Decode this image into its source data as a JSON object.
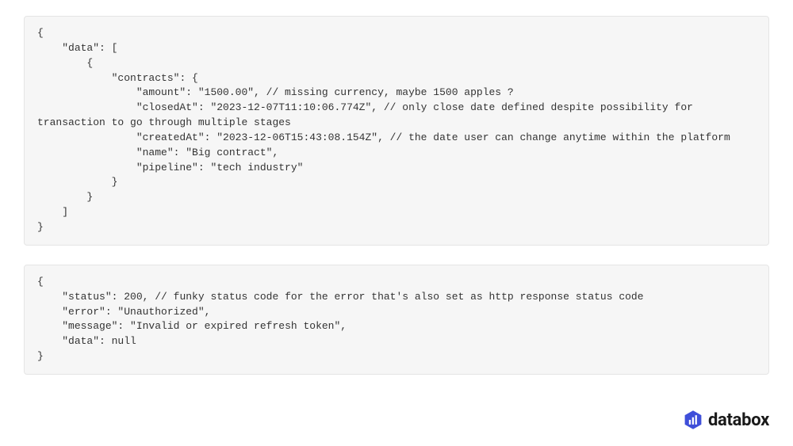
{
  "blocks": {
    "block1": "{\n    \"data\": [\n        {\n            \"contracts\": {\n                \"amount\": \"1500.00\", // missing currency, maybe 1500 apples ?\n                \"closedAt\": \"2023-12-07T11:10:06.774Z\", // only close date defined despite possibility for transaction to go through multiple stages\n                \"createdAt\": \"2023-12-06T15:43:08.154Z\", // the date user can change anytime within the platform\n                \"name\": \"Big contract\",\n                \"pipeline\": \"tech industry\"\n            }\n        }\n    ]\n}",
    "block2": "{\n    \"status\": 200, // funky status code for the error that's also set as http response status code\n    \"error\": \"Unauthorized\",\n    \"message\": \"Invalid or expired refresh token\",\n    \"data\": null\n}"
  },
  "logo": {
    "text": "databox"
  }
}
